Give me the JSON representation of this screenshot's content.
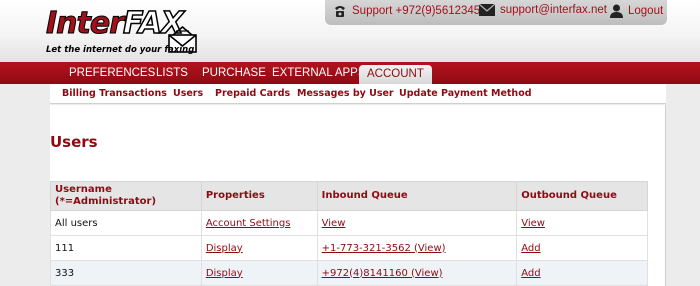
{
  "logo": {
    "inter": "Inter",
    "fax": "FAX",
    "tagline": "Let the internet do your faxing"
  },
  "topbar": {
    "support_phone": "Support +972(9)5612345",
    "support_email": "support@interfax.net",
    "logout": "Logout",
    "icons": [
      "phone-icon",
      "envelope-icon",
      "user-icon"
    ]
  },
  "nav": {
    "items": [
      {
        "label": "PREFERENCES"
      },
      {
        "label": "LISTS"
      },
      {
        "label": "PURCHASE"
      },
      {
        "label": "EXTERNAL APPS"
      },
      {
        "label": "ACCOUNT"
      }
    ],
    "active": "ACCOUNT"
  },
  "submenu": {
    "items": [
      {
        "label": "Billing Transactions"
      },
      {
        "label": "Users"
      },
      {
        "label": "Prepaid Cards"
      },
      {
        "label": "Messages by User"
      },
      {
        "label": "Update Payment Method"
      }
    ]
  },
  "page": {
    "title": "Users"
  },
  "table": {
    "headers": [
      "Username\n(*=Administrator)",
      "Properties",
      "Inbound Queue",
      "Outbound Queue"
    ],
    "header_username_line1": "Username",
    "header_username_line2": "(*=Administrator)",
    "rows": [
      {
        "username": "All users",
        "properties": "Account Settings",
        "inbound": "View",
        "outbound": "View"
      },
      {
        "username": "111",
        "properties": "Display",
        "inbound": "+1-773-321-3562 (View)",
        "outbound": "Add"
      },
      {
        "username": "333",
        "properties": "Display",
        "inbound": "+972(4)8141160 (View)",
        "outbound": "Add"
      }
    ]
  },
  "colors": {
    "brand_red": "#8e0a13",
    "nav_red": "#b4131d",
    "alt_row": "#eef3f8"
  }
}
